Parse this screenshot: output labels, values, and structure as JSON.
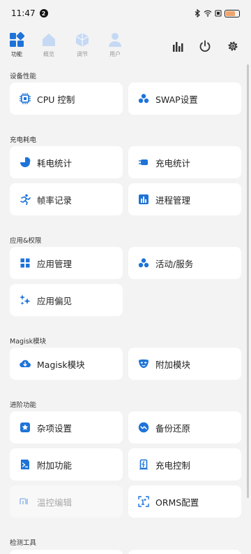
{
  "status_bar": {
    "time": "11:47",
    "notification_count": "2",
    "battery_label": "充电"
  },
  "top_nav": {
    "tabs": [
      {
        "label": "功能",
        "icon": "grid-icon",
        "active": true
      },
      {
        "label": "概览",
        "icon": "home-icon",
        "active": false
      },
      {
        "label": "调节",
        "icon": "cube-icon",
        "active": false
      },
      {
        "label": "用户",
        "icon": "user-icon",
        "active": false
      }
    ],
    "tools": [
      {
        "icon": "bar-chart-icon"
      },
      {
        "icon": "power-icon"
      },
      {
        "icon": "gear-icon"
      }
    ]
  },
  "sections": [
    {
      "title": "设备性能",
      "items": [
        {
          "label": "CPU 控制",
          "icon": "cpu-icon"
        },
        {
          "label": "SWAP设置",
          "icon": "cluster-icon"
        }
      ]
    },
    {
      "title": "充电耗电",
      "items": [
        {
          "label": "耗电统计",
          "icon": "pie-icon"
        },
        {
          "label": "充电统计",
          "icon": "charger-icon"
        },
        {
          "label": "帧率记录",
          "icon": "run-icon"
        },
        {
          "label": "进程管理",
          "icon": "process-icon"
        }
      ]
    },
    {
      "title": "应用&权限",
      "items": [
        {
          "label": "应用管理",
          "icon": "apps-icon"
        },
        {
          "label": "活动/服务",
          "icon": "cluster-icon"
        },
        {
          "label": "应用偏见",
          "icon": "sparkle-icon"
        }
      ]
    },
    {
      "title": "Magisk模块",
      "items": [
        {
          "label": "Magisk模块",
          "icon": "cloud-download-icon"
        },
        {
          "label": "附加模块",
          "icon": "mask-icon"
        }
      ]
    },
    {
      "title": "进阶功能",
      "items": [
        {
          "label": "杂项设置",
          "icon": "star-badge-icon"
        },
        {
          "label": "备份还原",
          "icon": "restore-icon"
        },
        {
          "label": "附加功能",
          "icon": "terminal-icon"
        },
        {
          "label": "充电控制",
          "icon": "charge-control-icon"
        },
        {
          "label": "温控编辑",
          "icon": "mi-icon",
          "disabled": true
        },
        {
          "label": "ORMS配置",
          "icon": "orms-icon"
        }
      ]
    },
    {
      "title": "检测工具",
      "items": []
    }
  ],
  "colors": {
    "accent": "#1e73d8",
    "tab_inactive": "#c6d9f4",
    "background": "#f3f3f3"
  }
}
